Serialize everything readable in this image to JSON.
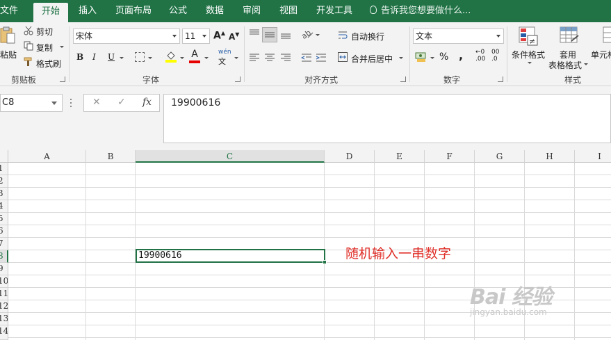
{
  "menu": {
    "tabs": [
      "文件",
      "开始",
      "插入",
      "页面布局",
      "公式",
      "数据",
      "审阅",
      "视图",
      "开发工具"
    ],
    "active": "开始",
    "tell_me": "告诉我您想要做什么..."
  },
  "ribbon": {
    "clipboard": {
      "paste": "粘贴",
      "cut": "剪切",
      "copy": "复制",
      "format_painter": "格式刷",
      "label": "剪贴板"
    },
    "font": {
      "font_name": "宋体",
      "font_size": "11",
      "bold": "B",
      "italic": "I",
      "underline": "U",
      "label": "字体",
      "grow": "A",
      "shrink": "A",
      "font_color_letter": "A",
      "wen": "wén",
      "wen_char": "文"
    },
    "alignment": {
      "wrap_text": "自动换行",
      "merge_center": "合并后居中",
      "label": "对齐方式"
    },
    "number": {
      "format": "文本",
      "percent": "%",
      "comma": ",",
      "inc_decimal": ".00",
      "inc_decimal_top": "←0",
      "dec_decimal": ".0",
      "dec_decimal_top": "00",
      "label": "数字"
    },
    "styles": {
      "conditional": "条件格式",
      "table_line1": "套用",
      "table_line2": "表格格式",
      "cell_styles": "单元格",
      "label": "样式"
    }
  },
  "formula_bar": {
    "name_box": "C8",
    "fx": "fx",
    "cancel": "✕",
    "enter": "✓",
    "formula": "19900616"
  },
  "grid": {
    "columns": [
      "A",
      "B",
      "C",
      "D",
      "E",
      "F",
      "G",
      "H",
      "I"
    ],
    "rows": [
      "1",
      "2",
      "3",
      "4",
      "5",
      "6",
      "7",
      "8",
      "9",
      "10",
      "11",
      "12",
      "13",
      "14"
    ],
    "selected_column": "C",
    "selected_row": "8",
    "selected_value": "19900616"
  },
  "annotation": "随机输入一串数字",
  "watermark": {
    "main": "Bai 经验",
    "sub": "jingyan.baidu.com"
  },
  "colors": {
    "accent": "#217346",
    "annotation": "#e0302a"
  }
}
